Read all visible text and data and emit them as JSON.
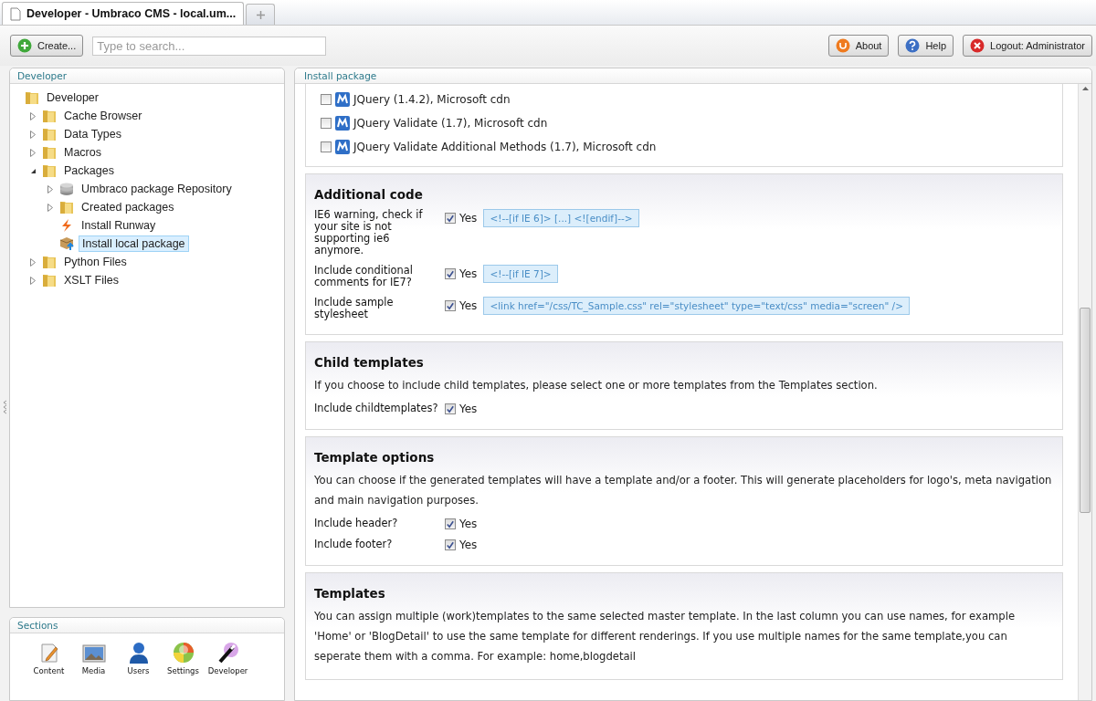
{
  "browser_tab": {
    "title": "Developer - Umbraco CMS - local.um..."
  },
  "toolbar": {
    "create_button": "Create...",
    "search": {
      "placeholder": "Type to search..."
    },
    "buttons": [
      {
        "kind": "about",
        "label": "About"
      },
      {
        "kind": "help",
        "label": "Help"
      },
      {
        "kind": "logout",
        "label": "Logout: Administrator"
      }
    ]
  },
  "tree_panel": {
    "title": "Developer",
    "items": [
      {
        "label": "Developer",
        "kind": "folder",
        "selected": false,
        "children": [
          {
            "label": "Cache Browser",
            "kind": "folder",
            "expanded": false,
            "selected": false
          },
          {
            "label": "Data Types",
            "kind": "folder",
            "expanded": false,
            "selected": false
          },
          {
            "label": "Macros",
            "kind": "folder",
            "expanded": false,
            "selected": false
          },
          {
            "label": "Packages",
            "kind": "folder",
            "expanded": true,
            "selected": false,
            "children": [
              {
                "label": "Umbraco package Repository",
                "kind": "database",
                "expanded": false,
                "selected": false
              },
              {
                "label": "Created packages",
                "kind": "folder",
                "expanded": false,
                "selected": false
              },
              {
                "label": "Install Runway",
                "kind": "runway",
                "selected": false
              },
              {
                "label": "Install local package",
                "kind": "package",
                "selected": true
              }
            ]
          },
          {
            "label": "Python Files",
            "kind": "folder",
            "expanded": false,
            "selected": false
          },
          {
            "label": "XSLT Files",
            "kind": "folder",
            "expanded": false,
            "selected": false
          }
        ]
      }
    ]
  },
  "sections_panel": {
    "title": "Sections",
    "items": [
      {
        "kind": "content",
        "label": "Content"
      },
      {
        "kind": "media",
        "label": "Media"
      },
      {
        "kind": "users",
        "label": "Users"
      },
      {
        "kind": "settings",
        "label": "Settings"
      },
      {
        "kind": "developer",
        "label": "Developer"
      }
    ]
  },
  "install_panel": {
    "title": "Install package",
    "libraries": [
      {
        "label": "JQuery (1.4.2), Microsoft cdn",
        "checked": false
      },
      {
        "label": "JQuery Validate (1.7), Microsoft cdn",
        "checked": false
      },
      {
        "label": "JQuery Validate Additional Methods (1.7), Microsoft cdn",
        "checked": false
      }
    ],
    "sections": [
      {
        "title": "Additional code",
        "options": [
          {
            "label": "IE6 warning, check if your site is not supporting ie6 anymore.",
            "checked": true,
            "value_label": "Yes",
            "code": "<!--[if IE 6]> [...] <![endif]-->"
          },
          {
            "label": "Include conditional comments for IE7?",
            "checked": true,
            "value_label": "Yes",
            "code": "<!--[if IE 7]>"
          },
          {
            "label": "Include sample stylesheet",
            "checked": true,
            "value_label": "Yes",
            "code": "<link href=\"/css/TC_Sample.css\" rel=\"stylesheet\" type=\"text/css\" media=\"screen\" />"
          }
        ]
      },
      {
        "title": "Child templates",
        "description": "If you choose to include child templates, please select one or more templates from the Templates section.",
        "options": [
          {
            "label": "Include childtemplates?",
            "checked": true,
            "value_label": "Yes"
          }
        ]
      },
      {
        "title": "Template options",
        "description": "You can choose if the generated templates will have a template and/or a footer. This will generate placeholders for logo's, meta navigation and main navigation purposes.",
        "options": [
          {
            "label": "Include header?",
            "checked": true,
            "value_label": "Yes"
          },
          {
            "label": "Include footer?",
            "checked": true,
            "value_label": "Yes"
          }
        ]
      },
      {
        "title": "Templates",
        "description": "You can assign multiple (work)templates to the same selected master template. In the last column you can use names, for example 'Home' or 'BlogDetail' to use the same template for different renderings. If you use multiple names for the same template,you can seperate them with a comma. For example: home,blogdetail"
      }
    ]
  }
}
